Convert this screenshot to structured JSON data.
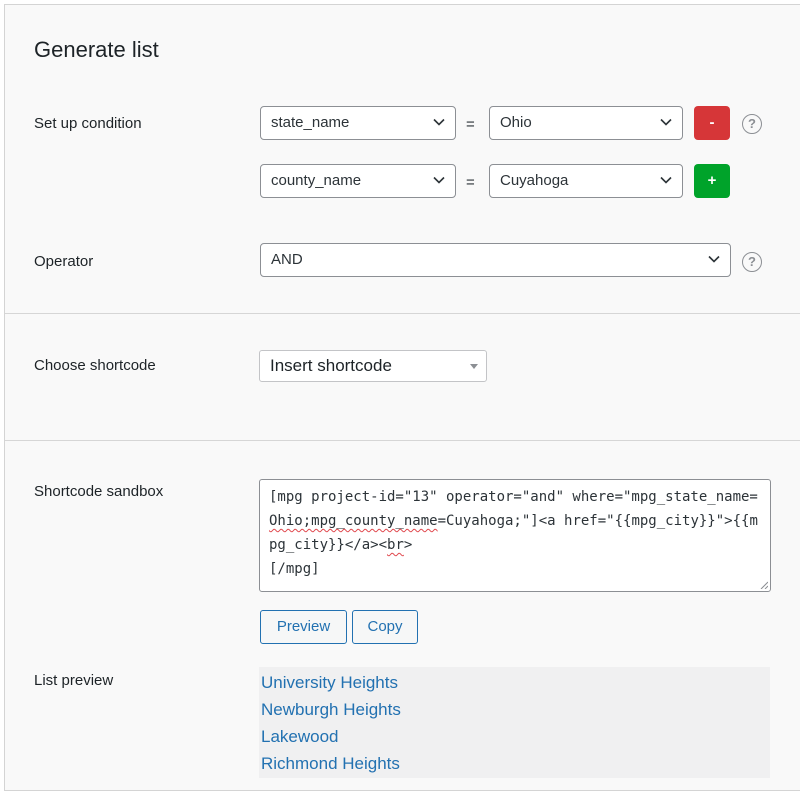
{
  "generate": {
    "title": "Generate list",
    "condition_label": "Set up condition",
    "conditions": [
      {
        "field": "state_name",
        "equals": "=",
        "value": "Ohio",
        "action": "-"
      },
      {
        "field": "county_name",
        "equals": "=",
        "value": "Cuyahoga",
        "action": "+"
      }
    ],
    "operator_label": "Operator",
    "operator_value": "AND",
    "help": "?"
  },
  "shortcode": {
    "label": "Choose shortcode",
    "select_value": "Insert shortcode"
  },
  "sandbox": {
    "label": "Shortcode sandbox",
    "text_parts": {
      "a": "[mpg project-id=\"13\" operator=\"and\" where=\"mpg_state_name=",
      "b": "Ohio;mpg_county_name",
      "c": "=Cuyahoga;\"]<a href=\"{{mpg_city}}\">{{mpg_city}}</a><",
      "d": "br",
      "e": ">\n[/mpg]"
    },
    "preview_button": "Preview",
    "copy_button": "Copy",
    "list_preview_label": "List preview",
    "cities": [
      "University Heights",
      "Newburgh Heights",
      "Lakewood",
      "Richmond Heights"
    ]
  },
  "colors": {
    "remove_button": "#d63638",
    "add_button": "#00a32a",
    "link": "#2271b1"
  }
}
